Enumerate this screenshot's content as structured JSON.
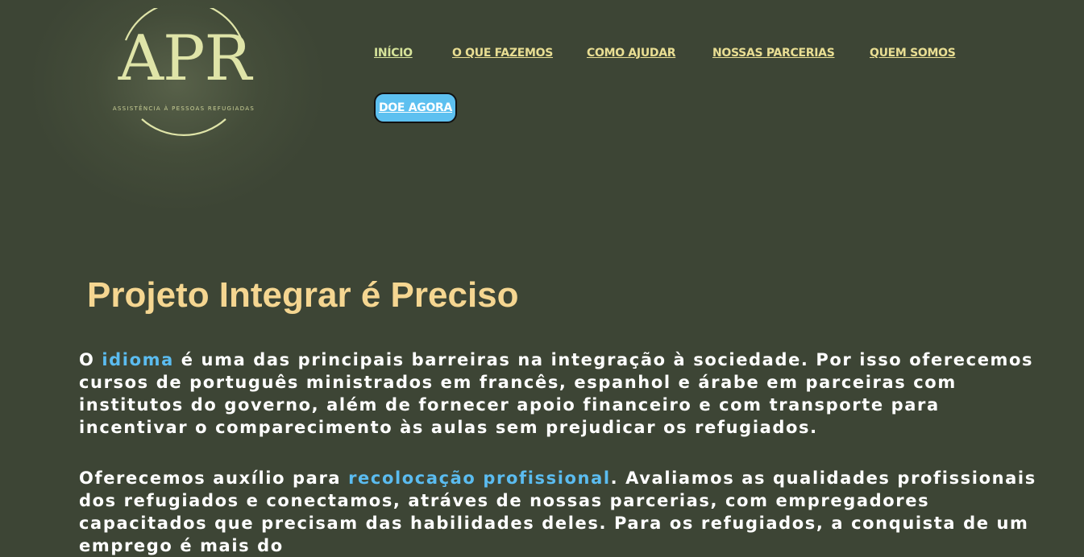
{
  "logo": {
    "text": "APR",
    "subtitle": "ASSISTÊNCIA À PESSOAS REFUGIADAS"
  },
  "nav": {
    "items": [
      "INÍCIO",
      "O QUE FAZEMOS",
      "COMO AJUDAR",
      "NOSSAS PARCERIAS",
      "QUEM SOMOS"
    ],
    "donate_label": "DOE AGORA"
  },
  "main": {
    "title": "Projeto Integrar é Preciso",
    "paragraph1": {
      "before": "O ",
      "highlight": "idioma",
      "after": " é uma das principais barreiras na integração à sociedade. Por isso oferecemos cursos de português ministrados em francês, espanhol e árabe em parceiras com institutos do governo, além de fornecer apoio financeiro e com transporte para incentivar o comparecimento às aulas sem prejudicar os refugiados."
    },
    "paragraph2": {
      "before": "Oferecemos auxílio para ",
      "highlight": "recolocação profissional",
      "after": ". Avaliamos as qualidades profissionais dos refugiados e conectamos, atráves de nossas parcerias, com empregadores capacitados que precisam das habilidades deles. Para os refugiados, a conquista de um emprego é mais do"
    }
  },
  "colors": {
    "background": "#3d4535",
    "nav_link": "#e9de93",
    "title": "#f5d691",
    "highlight": "#5bbcf0",
    "donate_button": "#5dc0f0"
  }
}
